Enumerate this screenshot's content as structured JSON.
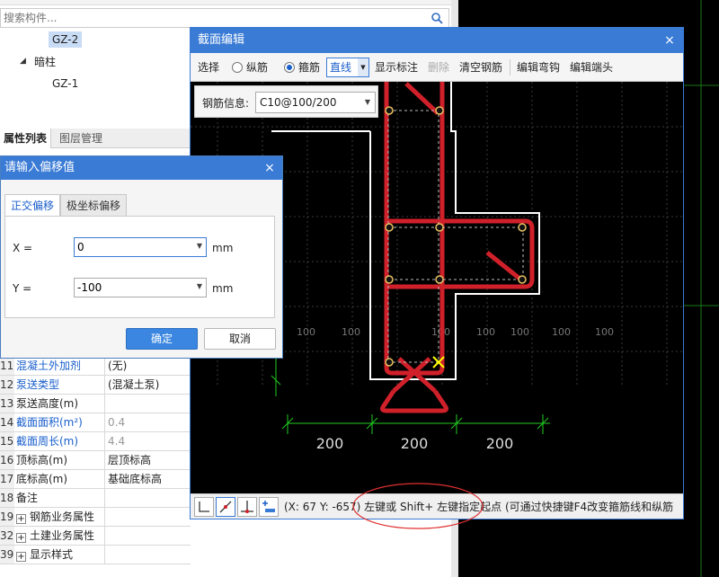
{
  "left": {
    "search_placeholder": "搜索构件...",
    "tree": {
      "selected": "GZ-2",
      "group": "暗柱",
      "child": "GZ-1"
    },
    "prop_tabs": {
      "props": "属性列表",
      "layers": "图层管理"
    },
    "rows": [
      {
        "num": "11",
        "name": "混凝土外加剂",
        "value": "(无)",
        "name_style": "blue",
        "value_style": ""
      },
      {
        "num": "12",
        "name": "泵送类型",
        "value": "(混凝土泵)",
        "name_style": "blue",
        "value_style": ""
      },
      {
        "num": "13",
        "name": "泵送高度(m)",
        "value": "",
        "name_style": "",
        "value_style": ""
      },
      {
        "num": "14",
        "name": "截面面积(m²)",
        "value": "0.4",
        "name_style": "blue",
        "value_style": "gray"
      },
      {
        "num": "15",
        "name": "截面周长(m)",
        "value": "4.4",
        "name_style": "blue",
        "value_style": "gray"
      },
      {
        "num": "16",
        "name": "顶标高(m)",
        "value": "层顶标高",
        "name_style": "",
        "value_style": ""
      },
      {
        "num": "17",
        "name": "底标高(m)",
        "value": "基础底标高",
        "name_style": "",
        "value_style": ""
      },
      {
        "num": "18",
        "name": "备注",
        "value": "",
        "name_style": "",
        "value_style": ""
      },
      {
        "num": "19",
        "name": "钢筋业务属性",
        "value": "",
        "name_style": "",
        "value_style": "",
        "expander": "+"
      },
      {
        "num": "32",
        "name": "土建业务属性",
        "value": "",
        "name_style": "",
        "value_style": "",
        "expander": "+"
      },
      {
        "num": "39",
        "name": "显示样式",
        "value": "",
        "name_style": "",
        "value_style": "",
        "expander": "+"
      }
    ]
  },
  "offset_dialog": {
    "title": "请输入偏移值",
    "close": "×",
    "tab_ortho": "正交偏移",
    "tab_polar": "极坐标偏移",
    "x_label": "X =",
    "x_value": "0",
    "y_label": "Y =",
    "y_value": "-100",
    "unit": "mm",
    "ok": "确定",
    "cancel": "取消"
  },
  "section": {
    "title": "截面编辑",
    "close": "×",
    "toolbar": {
      "select": "选择",
      "longitudinal": "纵筋",
      "stirrup": "箍筋",
      "line_mode": "直线",
      "show_labels": "显示标注",
      "delete": "删除",
      "clear": "清空钢筋",
      "edit_hook": "编辑弯钩",
      "edit_end": "编辑端头"
    },
    "rebar_label": "钢筋信息:",
    "rebar_value": "C10@100/200",
    "dims": [
      "200",
      "200",
      "200"
    ],
    "grid_labels": [
      "100",
      "100",
      "100",
      "100",
      "100",
      "100",
      "100"
    ],
    "status": "(X: 67 Y: -657) 左键或 Shift+ 左键指定起点 (可通过快捷键F4改变箍筋线和纵筋"
  },
  "colors": {
    "accent": "#3a7bd5",
    "rebar": "#d0202a",
    "outline": "#ffffff",
    "dim": "#22cc22",
    "highlight": "#ffff00",
    "annotation": "#e03030"
  }
}
